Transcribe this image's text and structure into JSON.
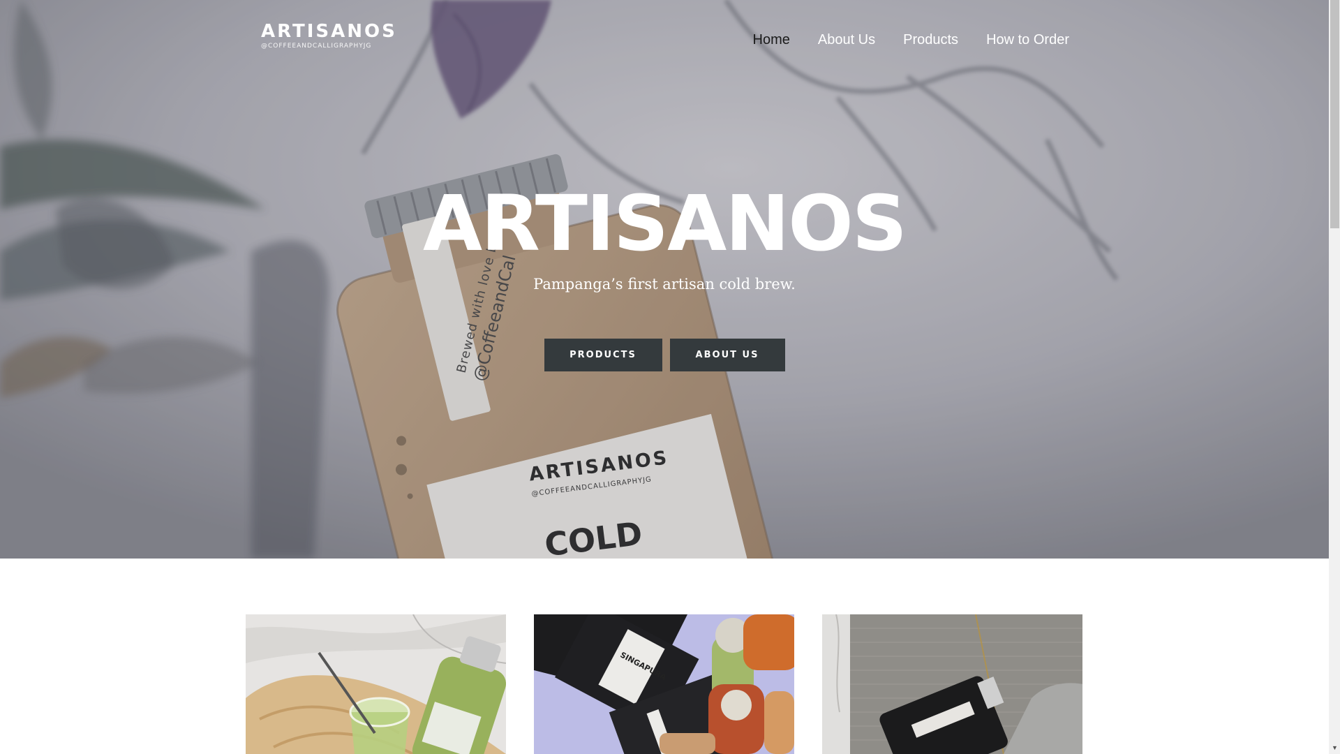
{
  "header": {
    "logo_name": "ARTISANOS",
    "logo_handle": "@COFFEEANDCALLIGRAPHYJG",
    "nav": [
      {
        "label": "Home",
        "active": true
      },
      {
        "label": "About Us",
        "active": false
      },
      {
        "label": "Products",
        "active": false
      },
      {
        "label": "How to Order",
        "active": false
      }
    ]
  },
  "hero": {
    "title": "ARTISANOS",
    "subtitle": "Pampanga’s first artisan cold brew.",
    "buttons": {
      "products": "PRODUCTS",
      "about": "ABOUT US"
    },
    "bottle_tag": "Brewed with love by",
    "bottle_tag_handle": "@CoffeeandCal",
    "bottle_label_brand": "ARTISANOS",
    "bottle_label_handle": "@COFFEEANDCALLIGRAPHYJG",
    "bottle_label_type": "COLD"
  },
  "cards": [
    {
      "name": "matcha-drink-photo"
    },
    {
      "name": "coffee-bags-bottles-photo",
      "bag_label": "SINGAPURA"
    },
    {
      "name": "bottle-on-fabric-photo"
    }
  ],
  "colors": {
    "button_bg": "#343a3d",
    "nav_active": "#1a1a1a",
    "text_light": "#ffffff"
  }
}
